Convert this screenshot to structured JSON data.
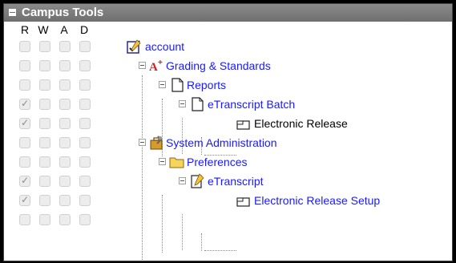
{
  "panel": {
    "title": "Campus Tools"
  },
  "columns": [
    "R",
    "W",
    "A",
    "D"
  ],
  "tree": [
    {
      "label": "account",
      "icon": "account-icon",
      "link": true,
      "checked": [
        false,
        false,
        false,
        false
      ]
    },
    {
      "label": "Grading & Standards",
      "icon": "grading-icon",
      "link": true,
      "checked": [
        false,
        false,
        false,
        false
      ]
    },
    {
      "label": "Reports",
      "icon": "document-icon",
      "link": true,
      "checked": [
        false,
        false,
        false,
        false
      ]
    },
    {
      "label": "eTranscript Batch",
      "icon": "document-icon",
      "link": true,
      "checked": [
        true,
        false,
        false,
        false
      ]
    },
    {
      "label": "Electronic Release",
      "icon": "tool-leaf-icon",
      "link": false,
      "checked": [
        true,
        false,
        false,
        false
      ]
    },
    {
      "label": "System Administration",
      "icon": "system-admin-icon",
      "link": true,
      "checked": [
        false,
        false,
        false,
        false
      ]
    },
    {
      "label": "Preferences",
      "icon": "folder-icon",
      "link": true,
      "checked": [
        false,
        false,
        false,
        false
      ]
    },
    {
      "label": "eTranscript",
      "icon": "edit-document-icon",
      "link": true,
      "checked": [
        true,
        false,
        false,
        false
      ]
    },
    {
      "label": "Electronic Release Setup",
      "icon": "tool-leaf-icon",
      "link": true,
      "checked": [
        true,
        false,
        false,
        false
      ]
    }
  ]
}
